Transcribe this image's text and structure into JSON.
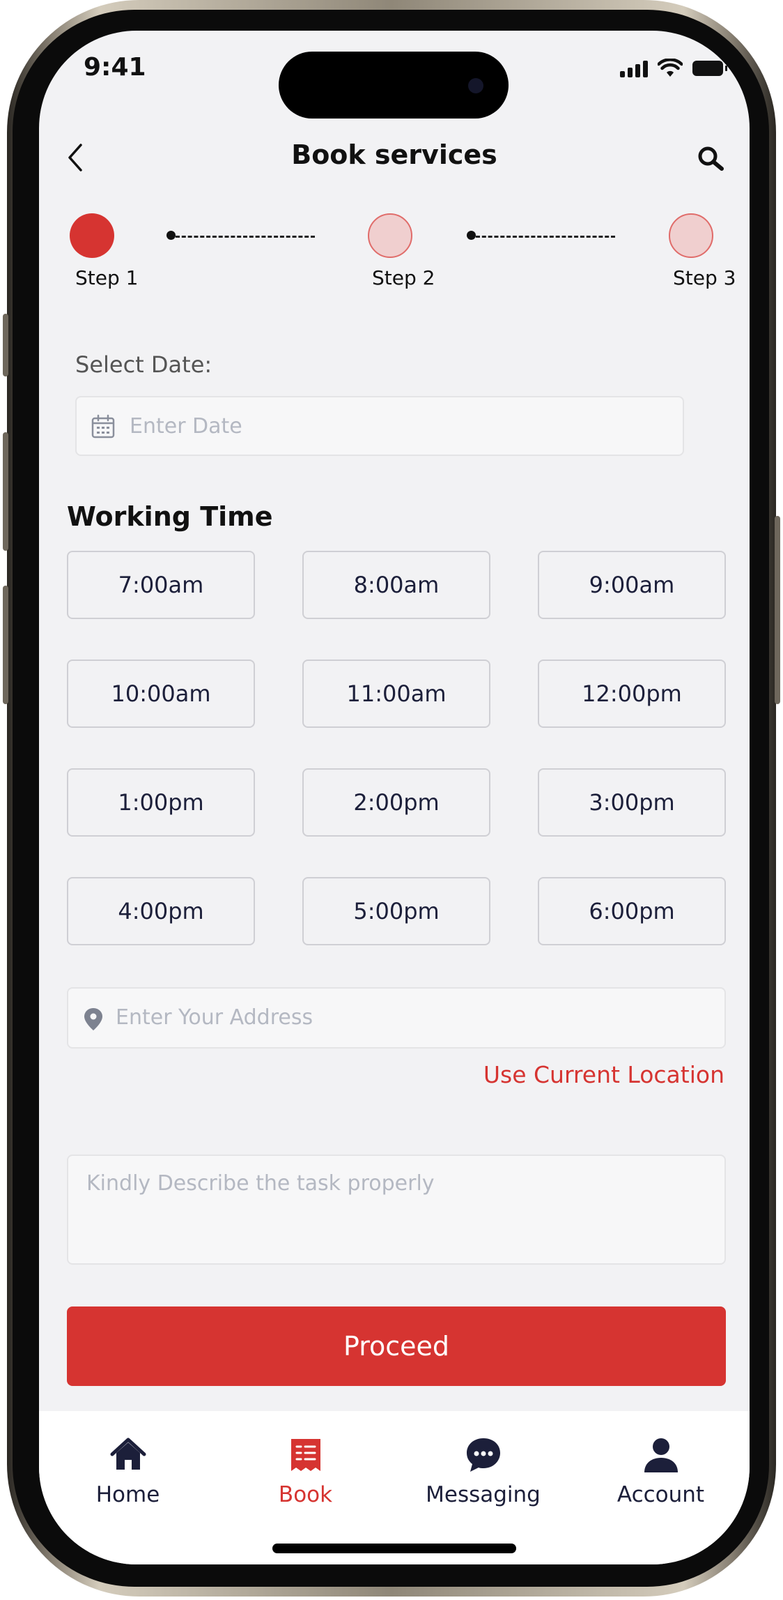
{
  "status": {
    "time": "9:41"
  },
  "header": {
    "title": "Book services"
  },
  "steps": [
    {
      "label": "Step 1",
      "state": "active"
    },
    {
      "label": "Step 2",
      "state": "inactive"
    },
    {
      "label": "Step 3",
      "state": "inactive"
    }
  ],
  "form": {
    "date_label": "Select Date:",
    "date_placeholder": "Enter Date",
    "working_time_title": "Working Time",
    "time_slots": [
      "7:00am",
      "8:00am",
      "9:00am",
      "10:00am",
      "11:00am",
      "12:00pm",
      "1:00pm",
      "2:00pm",
      "3:00pm",
      "4:00pm",
      "5:00pm",
      "6:00pm"
    ],
    "address_placeholder": "Enter Your Address",
    "use_location_label": "Use Current Location",
    "description_placeholder": "Kindly Describe the task properly",
    "proceed_label": "Proceed"
  },
  "tabbar": {
    "items": [
      {
        "label": "Home",
        "icon": "home-icon"
      },
      {
        "label": "Book",
        "icon": "book-icon",
        "active": true
      },
      {
        "label": "Messaging",
        "icon": "chat-bubble-icon"
      },
      {
        "label": "Account",
        "icon": "person-icon"
      }
    ]
  },
  "colors": {
    "accent": "#d63431",
    "text_dark": "#1c1f3a",
    "screen_bg": "#f2f2f4"
  }
}
